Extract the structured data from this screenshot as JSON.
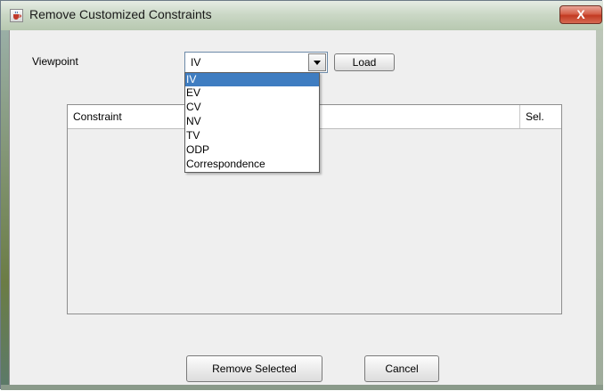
{
  "window": {
    "title": "Remove Customized Constraints",
    "close_glyph": "X",
    "icon": "java-cup-icon"
  },
  "form": {
    "viewpoint_label": "Viewpoint",
    "viewpoint_value": "IV",
    "load_label": "Load"
  },
  "dropdown": {
    "options": [
      "IV",
      "EV",
      "CV",
      "NV",
      "TV",
      "ODP",
      "Correspondence"
    ],
    "selected_index": 0
  },
  "table": {
    "columns": [
      "Constraint",
      "Sel."
    ],
    "rows": []
  },
  "buttons": {
    "remove_selected": "Remove Selected",
    "cancel": "Cancel"
  },
  "colors": {
    "selection": "#3f7dc1",
    "close_button": "#c23a22",
    "dialog_background": "#efefef"
  }
}
